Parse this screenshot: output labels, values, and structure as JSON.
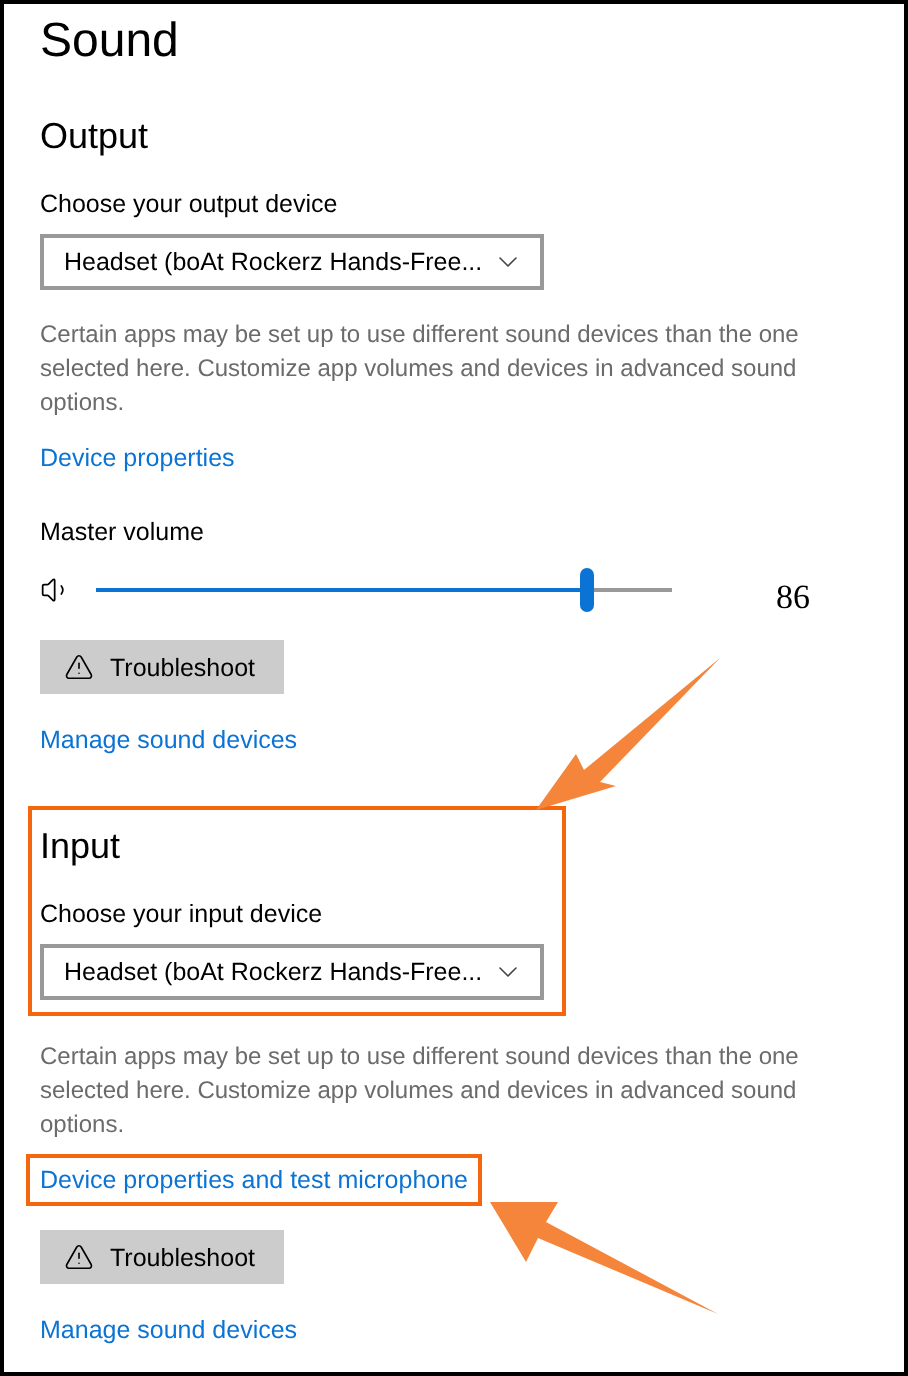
{
  "title": "Sound",
  "sections": [
    {
      "heading": "Output",
      "highlighted": false,
      "device_label": "Choose your output device",
      "device": "Headset (boAt Rockerz Hands-Free...",
      "description": "Certain apps may be set up to use different sound devices than the one selected here. Customize app volumes and devices in advanced sound options.",
      "link": {
        "text": "Device properties",
        "highlighted": false
      },
      "volume": {
        "label": "Master volume",
        "level": 0.85,
        "reading": "86"
      },
      "troubleshoot": "Troubleshoot",
      "manage_link": "Manage sound devices"
    },
    {
      "heading": "Input",
      "highlighted": true,
      "device_label": "Choose your input device",
      "device": "Headset (boAt Rockerz Hands-Free...",
      "description": "Certain apps may be set up to use different sound devices than the one selected here. Customize app volumes and devices in advanced sound options.",
      "link": {
        "text": "Device properties and test microphone",
        "highlighted": true
      },
      "troubleshoot": "Troubleshoot",
      "manage_link": "Manage sound devices"
    }
  ]
}
